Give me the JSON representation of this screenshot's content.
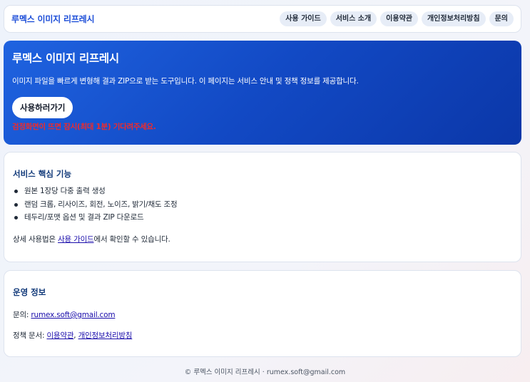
{
  "header": {
    "brand": "루멕스 이미지 리프레시",
    "nav": [
      "사용 가이드",
      "서비스 소개",
      "이용약관",
      "개인정보처리방침",
      "문의"
    ]
  },
  "hero": {
    "title": "루멕스 이미지 리프레시",
    "description": "이미지 파일을 빠르게 변형해 결과 ZIP으로 받는 도구입니다. 이 페이지는 서비스 안내 및 정책 정보를 제공합니다.",
    "button_label": "사용하러가기",
    "warning": "검정화면이 뜨면 잠시(최대 1분) 기다려주세요."
  },
  "features": {
    "title": "서비스 핵심 기능",
    "items": [
      "원본 1장당 다중 출력 생성",
      "랜덤 크롭, 리사이즈, 회전, 노이즈, 밝기/채도 조정",
      "테두리/포맷 옵션 및 결과 ZIP 다운로드"
    ],
    "note_prefix": "상세 사용법은 ",
    "note_link": "사용 가이드",
    "note_suffix": "에서 확인할 수 있습니다."
  },
  "ops": {
    "title": "운영 정보",
    "contact_label": "문의: ",
    "contact_email": "rumex.soft@gmail.com",
    "policy_label": "정책 문서: ",
    "policy_terms": "이용약관",
    "policy_sep": ", ",
    "policy_privacy": "개인정보처리방침"
  },
  "footer": {
    "text": "© 루멕스 이미지 리프레시 · rumex.soft@gmail.com"
  }
}
